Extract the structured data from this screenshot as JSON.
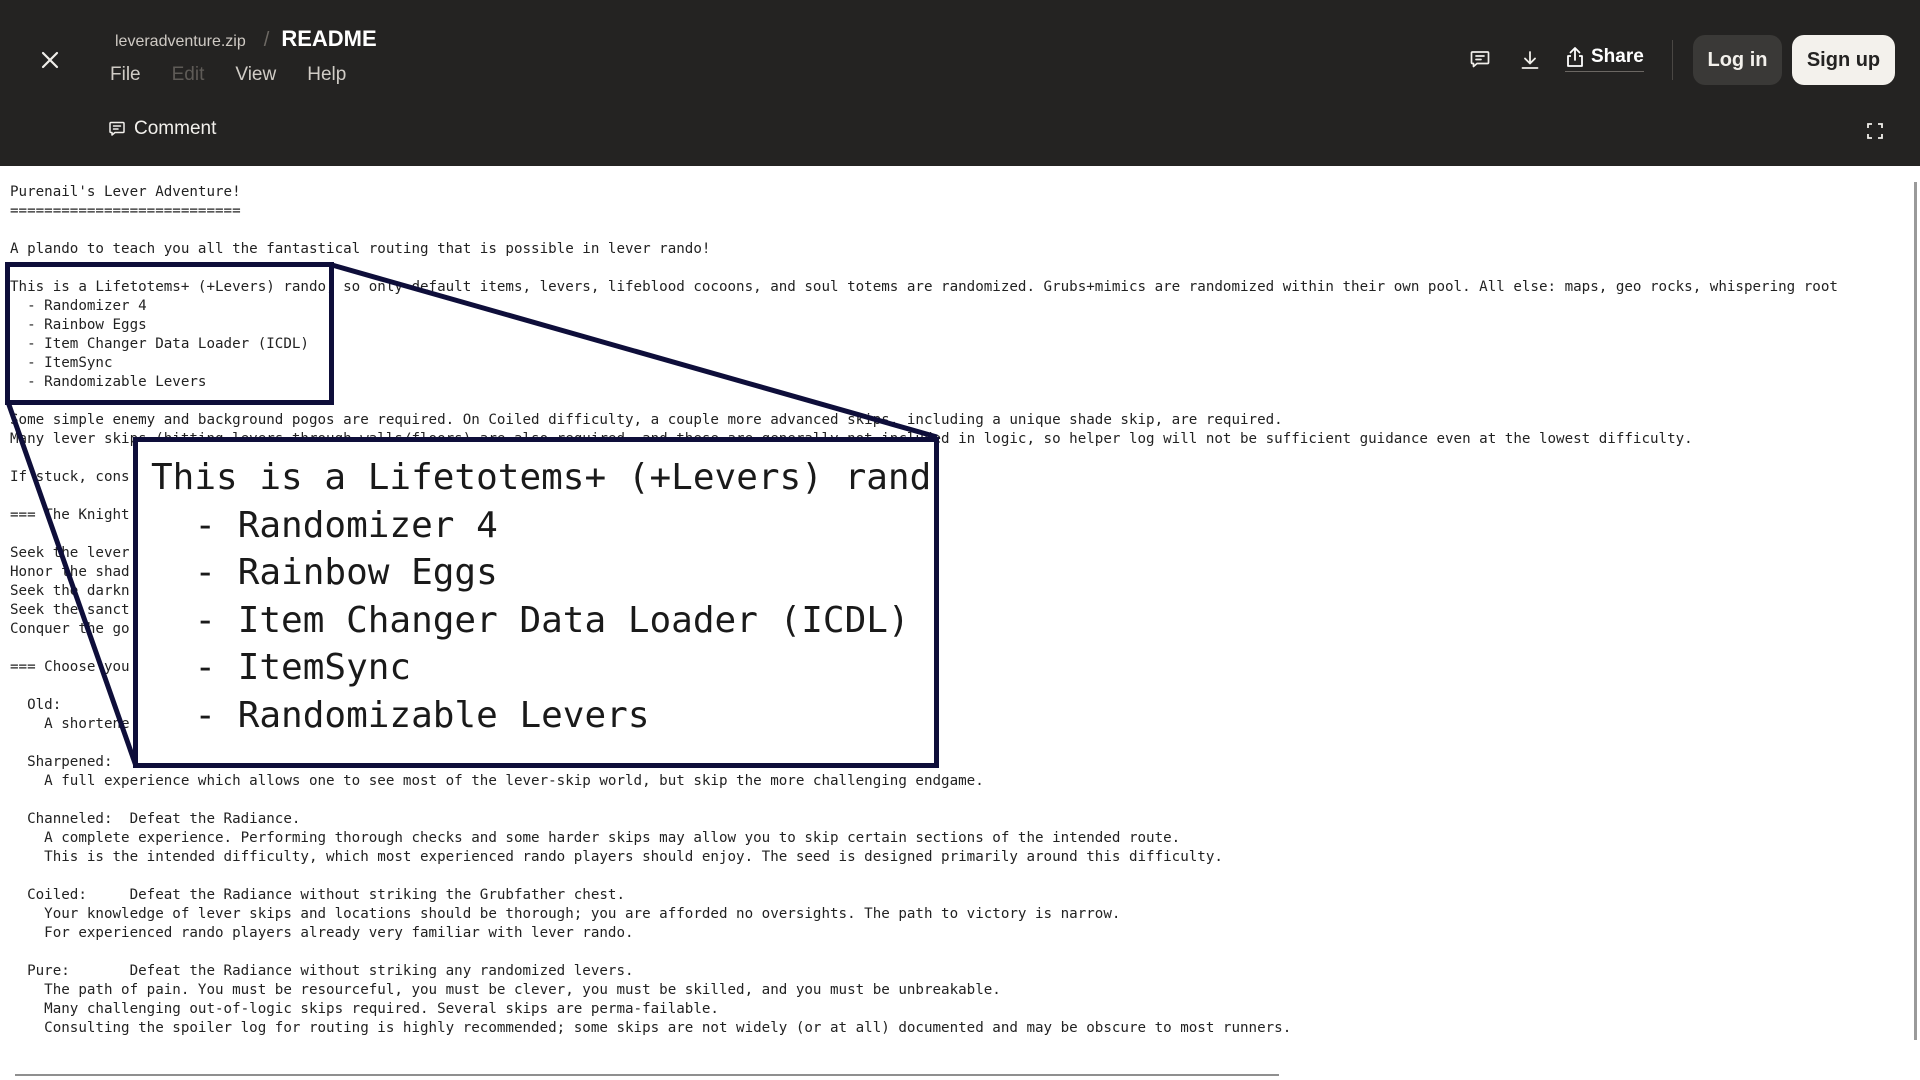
{
  "header": {
    "archive_name": "leveradventure.zip",
    "separator": "/",
    "file_title": "README",
    "menu": [
      {
        "label": "File",
        "enabled": true
      },
      {
        "label": "Edit",
        "enabled": false
      },
      {
        "label": "View",
        "enabled": true
      },
      {
        "label": "Help",
        "enabled": true
      }
    ],
    "comment_label": "Comment",
    "share_label": "Share",
    "login_label": "Log in",
    "signup_label": "Sign up",
    "icons": {
      "close": "close-icon",
      "comments": "comment-icon",
      "download": "download-icon",
      "share": "share-icon",
      "fullscreen": "fullscreen-icon"
    }
  },
  "document": {
    "lines": [
      "Purenail's Lever Adventure!",
      "===========================",
      "",
      "A plando to teach you all the fantastical routing that is possible in lever rando!",
      "",
      "This is a Lifetotems+ (+Levers) rando, so only default items, levers, lifeblood cocoons, and soul totems are randomized. Grubs+mimics are randomized within their own pool. All else: maps, geo rocks, whispering root",
      "  - Randomizer 4",
      "  - Rainbow Eggs",
      "  - Item Changer Data Loader (ICDL)",
      "  - ItemSync",
      "  - Randomizable Levers",
      "",
      "Some simple enemy and background pogos are required. On Coiled difficulty, a couple more advanced skips, including a unique shade skip, are required.",
      "Many lever skips (hitting levers through walls/floors) are also required, and these are generally not included in logic, so helper log will not be sufficient guidance even at the lowest difficulty.",
      "",
      "If stuck, cons",
      "",
      "=== The Knight",
      "",
      "Seek the lever",
      "Honor the shad",
      "Seek the darkn",
      "Seek the sanct",
      "Conquer the go",
      "",
      "=== Choose you",
      "",
      "  Old:",
      "    A shortene",
      "",
      "  Sharpened:",
      "    A full experience which allows one to see most of the lever-skip world, but skip the more challenging endgame.",
      "",
      "  Channeled:  Defeat the Radiance.",
      "    A complete experience. Performing thorough checks and some harder skips may allow you to skip certain sections of the intended route.",
      "    This is the intended difficulty, which most experienced rando players should enjoy. The seed is designed primarily around this difficulty.",
      "",
      "  Coiled:     Defeat the Radiance without striking the Grubfather chest.",
      "    Your knowledge of lever skips and locations should be thorough; you are afforded no oversights. The path to victory is narrow.",
      "    For experienced rando players already very familiar with lever rando.",
      "",
      "  Pure:       Defeat the Radiance without striking any randomized levers.",
      "    The path of pain. You must be resourceful, you must be clever, you must be skilled, and you must be unbreakable.",
      "    Many challenging out-of-logic skips required. Several skips are perma-failable.",
      "    Consulting the spoiler log for routing is highly recommended; some skips are not widely (or at all) documented and may be obscure to most runners."
    ]
  },
  "zoom_callout": {
    "lines": [
      "This is a Lifetotems+ (+Levers) rand",
      "  - Randomizer 4",
      "  - Rainbow Eggs",
      "  - Item Changer Data Loader (ICDL)",
      "  - ItemSync",
      "  - Randomizable Levers"
    ],
    "border_color": "#0e0e3a"
  }
}
